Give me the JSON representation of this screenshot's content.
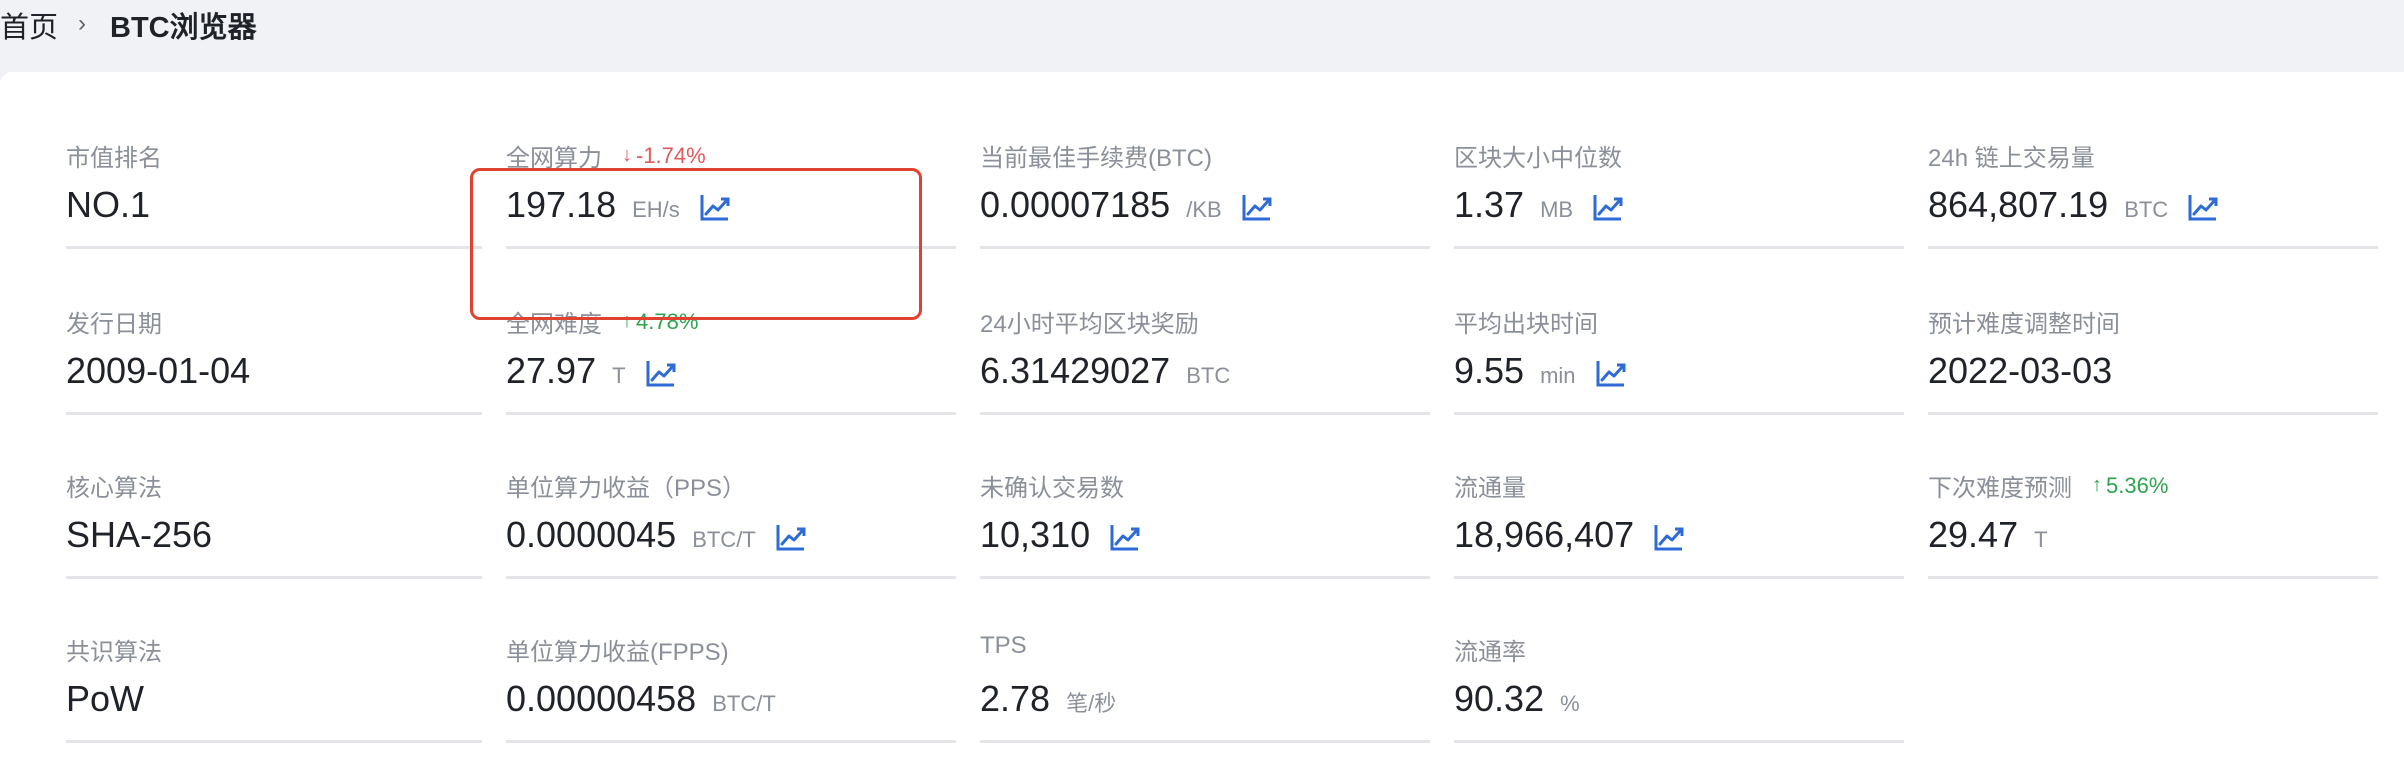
{
  "breadcrumb": {
    "home": "首页",
    "separator": "›",
    "current": "BTC浏览器"
  },
  "colors": {
    "up": "#2fa44f",
    "down": "#e05a59",
    "chart_icon": "#2f6bd6",
    "highlight": "#e0422f"
  },
  "rows": [
    [
      {
        "label": "市值排名",
        "value": "NO.1",
        "unit": "",
        "chart": false,
        "change": null
      },
      {
        "label": "全网算力",
        "value": "197.18",
        "unit": "EH/s",
        "chart": true,
        "change": {
          "dir": "down",
          "arrow": "↓",
          "text": "-1.74%"
        }
      },
      {
        "label": "当前最佳手续费(BTC)",
        "value": "0.00007185",
        "unit": "/KB",
        "chart": true,
        "change": null
      },
      {
        "label": "区块大小中位数",
        "value": "1.37",
        "unit": "MB",
        "chart": true,
        "change": null
      },
      {
        "label": "24h 链上交易量",
        "value": "864,807.19",
        "unit": "BTC",
        "chart": true,
        "change": null
      }
    ],
    [
      {
        "label": "发行日期",
        "value": "2009-01-04",
        "unit": "",
        "chart": false,
        "change": null
      },
      {
        "label": "全网难度",
        "value": "27.97",
        "unit": "T",
        "chart": true,
        "change": {
          "dir": "up",
          "arrow": "↑",
          "text": "4.78%"
        }
      },
      {
        "label": "24小时平均区块奖励",
        "value": "6.31429027",
        "unit": "BTC",
        "chart": false,
        "change": null
      },
      {
        "label": "平均出块时间",
        "value": "9.55",
        "unit": "min",
        "chart": true,
        "change": null
      },
      {
        "label": "预计难度调整时间",
        "value": "2022-03-03",
        "unit": "",
        "chart": false,
        "change": null
      }
    ],
    [
      {
        "label": "核心算法",
        "value": "SHA-256",
        "unit": "",
        "chart": false,
        "change": null
      },
      {
        "label": "单位算力收益（PPS）",
        "value": "0.0000045",
        "unit": "BTC/T",
        "chart": true,
        "change": null
      },
      {
        "label": "未确认交易数",
        "value": "10,310",
        "unit": "",
        "chart": true,
        "change": null
      },
      {
        "label": "流通量",
        "value": "18,966,407",
        "unit": "",
        "chart": true,
        "change": null
      },
      {
        "label": "下次难度预测",
        "value": "29.47",
        "unit": "T",
        "chart": false,
        "change": {
          "dir": "up",
          "arrow": "↑",
          "text": "5.36%"
        }
      }
    ],
    [
      {
        "label": "共识算法",
        "value": "PoW",
        "unit": "",
        "chart": false,
        "change": null
      },
      {
        "label": "单位算力收益(FPPS)",
        "value": "0.00000458",
        "unit": "BTC/T",
        "chart": false,
        "change": null
      },
      {
        "label": "TPS",
        "value": "2.78",
        "unit": "笔/秒",
        "chart": false,
        "change": null
      },
      {
        "label": "流通率",
        "value": "90.32",
        "unit": "%",
        "chart": false,
        "change": null
      },
      null
    ]
  ]
}
